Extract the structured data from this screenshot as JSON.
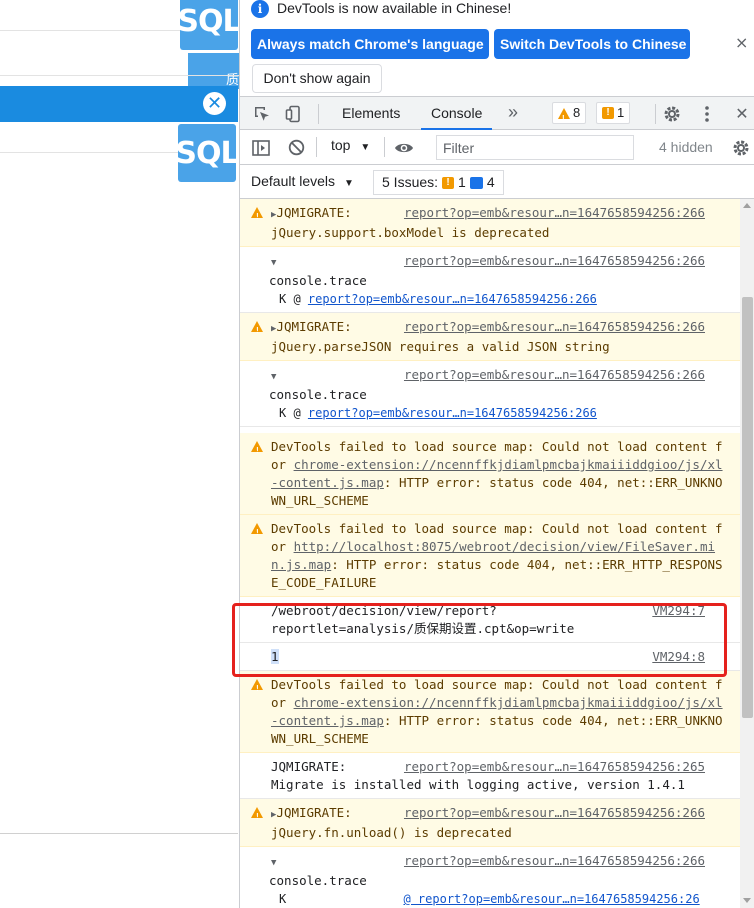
{
  "background_page": {
    "sql_badge_1": "SQL",
    "sql_badge_2": "SQL",
    "side_tab": "质",
    "dialog_close": "✕"
  },
  "infobar": {
    "message": "DevTools is now available in Chinese!",
    "match_language_button": "Always match Chrome's language",
    "switch_button": "Switch DevTools to Chinese",
    "dont_show_button": "Don't show again",
    "close": "×"
  },
  "tabs": {
    "items": [
      {
        "label": "Elements"
      },
      {
        "label": "Console"
      }
    ],
    "more": "»",
    "warnings_count": "8",
    "errors_count": "1",
    "close": "✕"
  },
  "toolbar": {
    "context": "top",
    "filter_placeholder": "Filter",
    "hidden": "4 hidden"
  },
  "toolbar2": {
    "levels": "Default levels",
    "issues_label": "5 Issues:",
    "issues_warn": "1",
    "issues_info": "4"
  },
  "messages": [
    {
      "type": "warn",
      "prefix": "JQMIGRATE: ",
      "source": "report?op=emb&resour…n=1647658594256:266",
      "text": "jQuery.support.boxModel is deprecated"
    },
    {
      "type": "trace",
      "source": "report?op=emb&resour…n=1647658594256:266",
      "text": "console.trace",
      "frame_fn": "K @ ",
      "frame_link": "report?op=emb&resour…n=1647658594256:266"
    },
    {
      "type": "warn",
      "prefix": "JQMIGRATE: ",
      "source": "report?op=emb&resour…n=1647658594256:266",
      "text": "jQuery.parseJSON requires a valid JSON string"
    },
    {
      "type": "trace",
      "source": "report?op=emb&resour…n=1647658594256:266",
      "text": "console.trace",
      "frame_fn": "K @ ",
      "frame_link": "report?op=emb&resour…n=1647658594256:266"
    },
    {
      "type": "warn-long",
      "text_a": "DevTools failed to load source map: Could not load content for ",
      "link": "chrome-extension://ncennffkjdiamlpmcbajkmaiiiddgioo/js/xl-content.js.map",
      "text_b": ": HTTP error: status code 404, net::ERR_UNKNOWN_URL_SCHEME"
    },
    {
      "type": "warn-long",
      "text_a": "DevTools failed to load source map: Could not load content for ",
      "link": "http://localhost:8075/webroot/decision/view/FileSaver.min.js.map",
      "text_b": ": HTTP error: status code 404, net::ERR_HTTP_RESPONSE_CODE_FAILURE"
    },
    {
      "type": "log",
      "source": "VM294:7",
      "text": "/webroot/decision/view/report?\nreportlet=analysis/质保期设置.cpt&op=write"
    },
    {
      "type": "log",
      "source": "VM294:8",
      "text": "1"
    },
    {
      "type": "warn-long",
      "text_a": "DevTools failed to load source map: Could not load content for ",
      "link": "chrome-extension://ncennffkjdiamlpmcbajkmaiiiddgioo/js/xl-content.js.map",
      "text_b": ": HTTP error: status code 404, net::ERR_UNKNOWN_URL_SCHEME"
    },
    {
      "type": "log",
      "source": "report?op=emb&resour…n=1647658594256:265",
      "text": "JQMIGRATE:  ",
      "text2": "Migrate is installed with logging active, version 1.4.1"
    },
    {
      "type": "warn",
      "prefix": "JQMIGRATE: ",
      "source": "report?op=emb&resour…n=1647658594256:266",
      "text": "jQuery.fn.unload() is deprecated"
    },
    {
      "type": "trace",
      "source": "report?op=emb&resour…n=1647658594256:266",
      "text": "console.trace",
      "frame_fn": "K",
      "frame_link": "@ report?op=emb&resour…n=1647658594256:26"
    }
  ]
}
